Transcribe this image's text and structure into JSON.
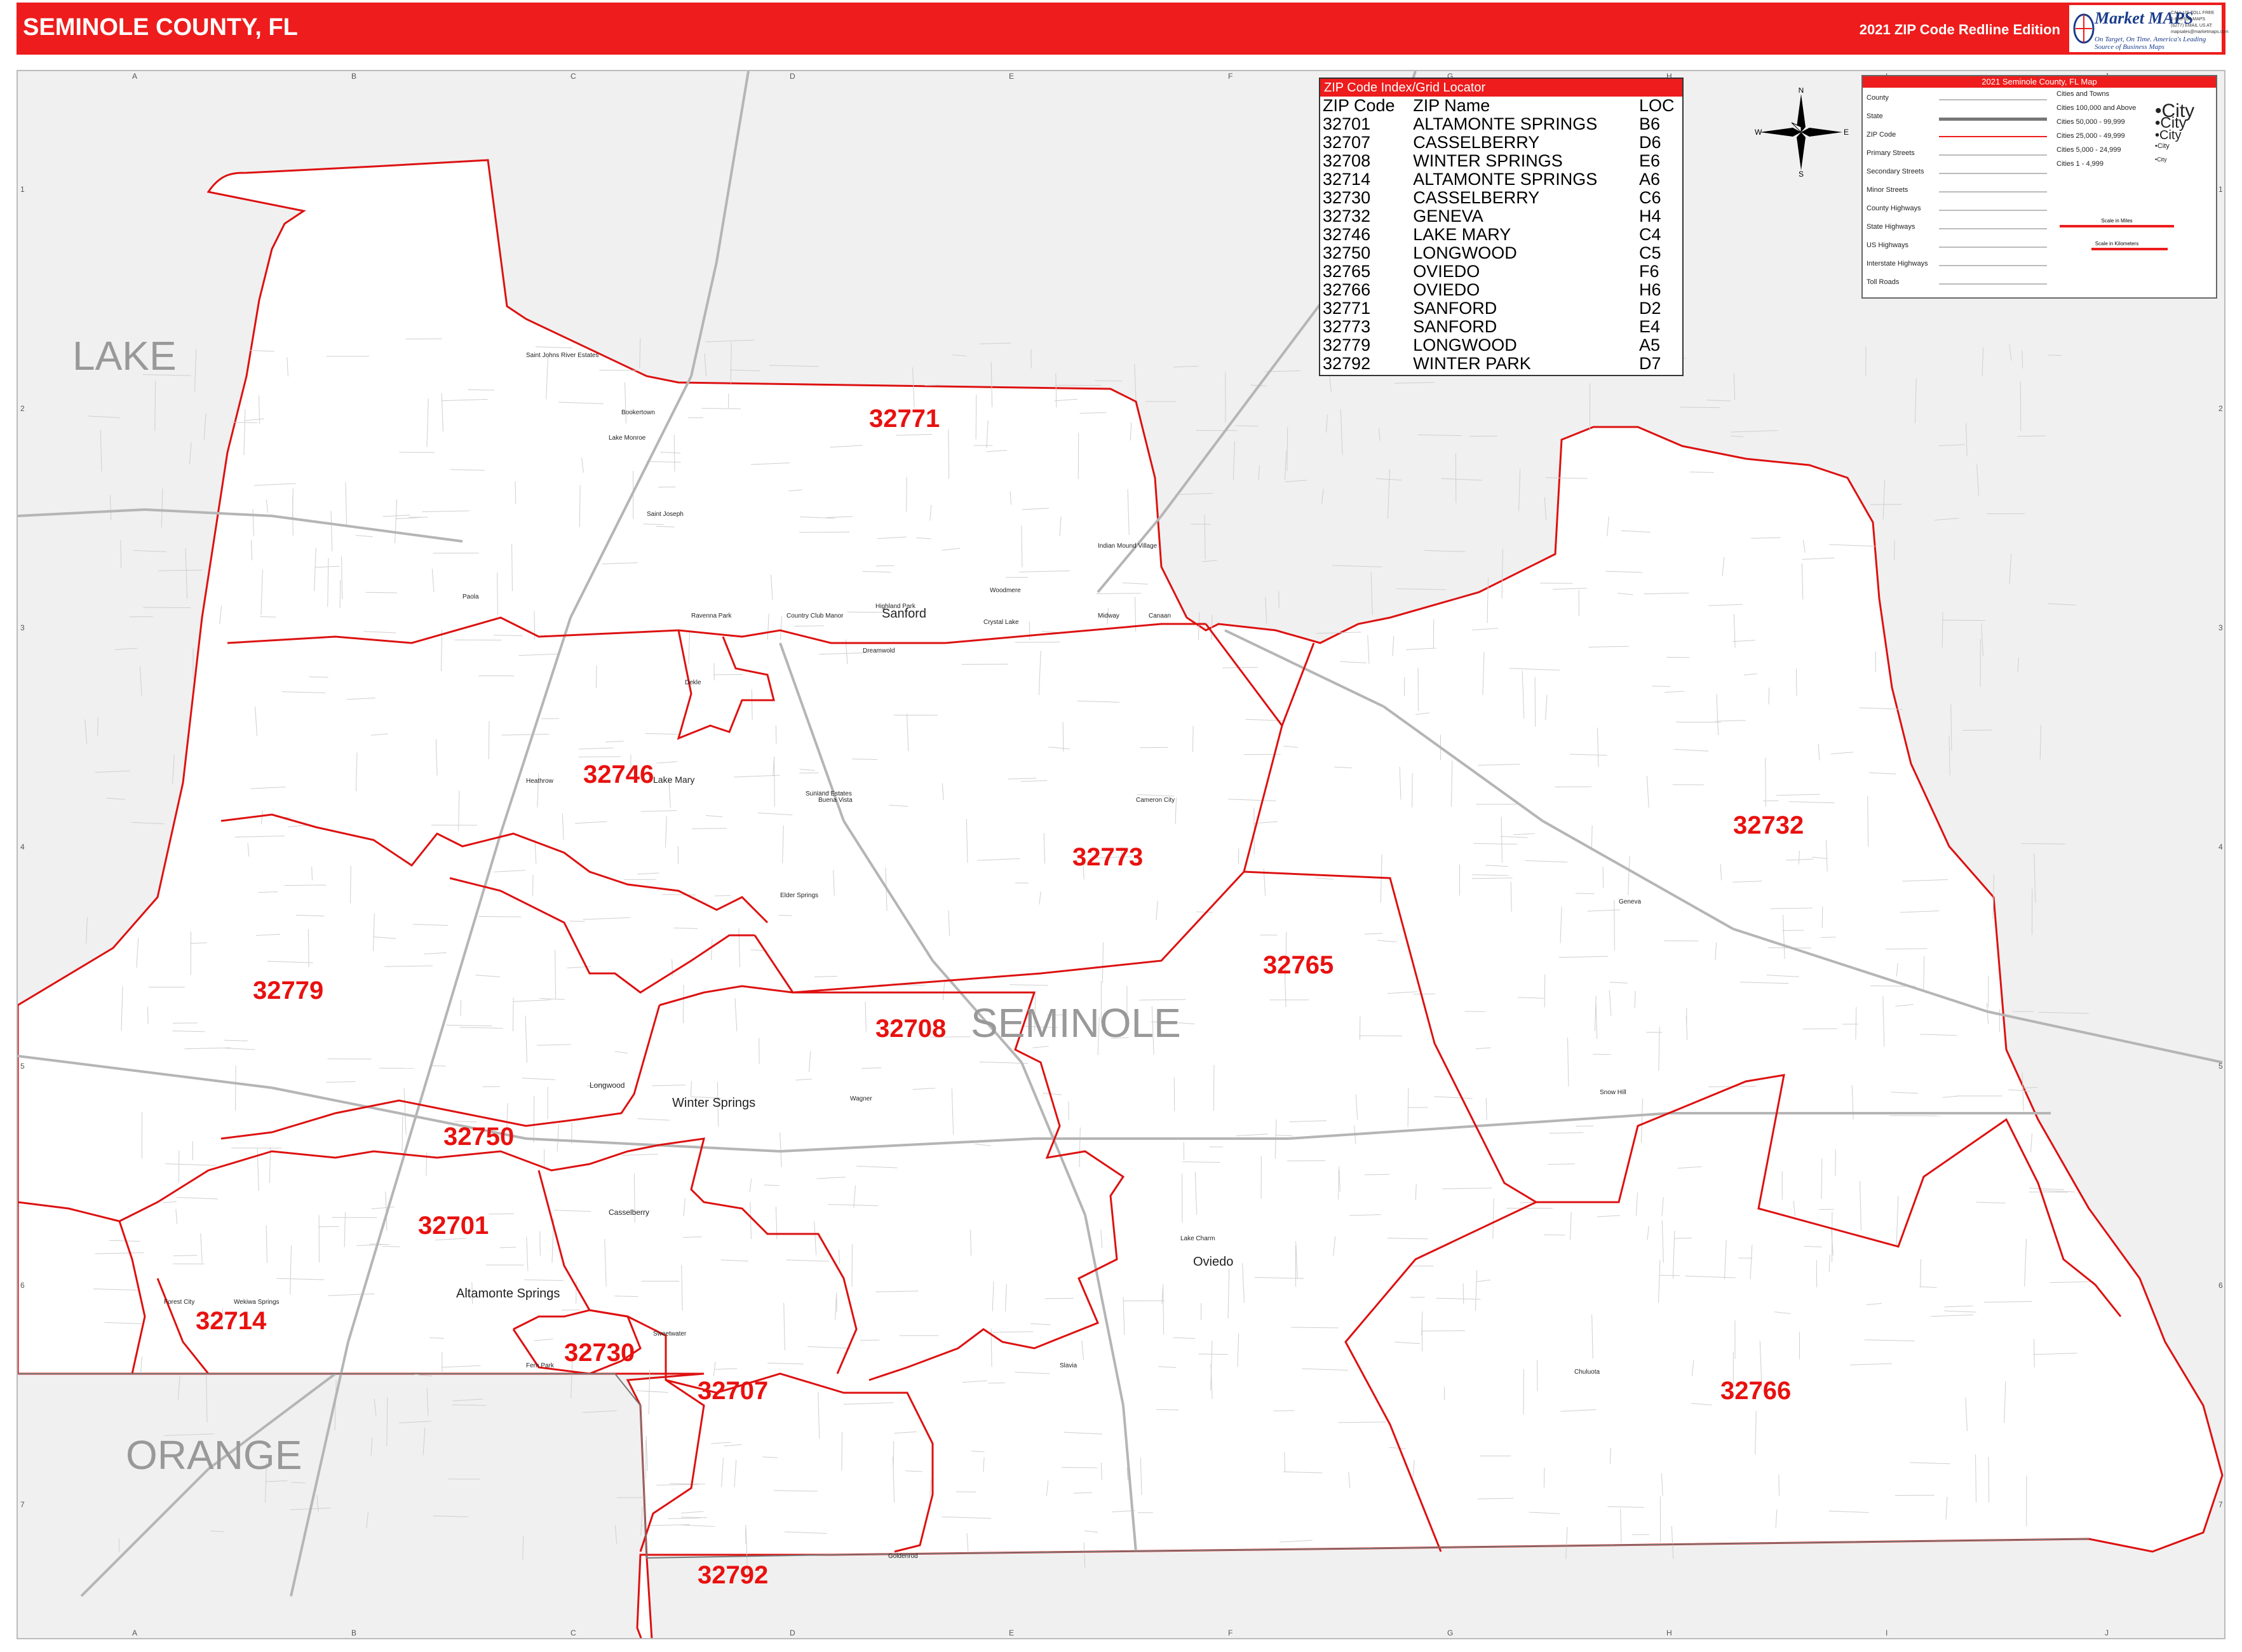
{
  "header": {
    "title": "SEMINOLE COUNTY, FL",
    "edition": "2021 ZIP Code Redline Edition"
  },
  "logo": {
    "name": "Market MAPS",
    "tagline": "On Target, On Time. America's Leading Source of Business Maps",
    "contact": "CALL US TOLL FREE 1-800-654-MAPS (6277) EMAIL US AT: mapsales@marketmaps.com"
  },
  "colors": {
    "accent": "#ee1c1c",
    "zip_boundary": "#dd1111",
    "roads": "#bbbbbb",
    "outside_county": "#f0f0f0",
    "county_label": "#999999"
  },
  "compass": {
    "n": "N",
    "s": "S",
    "e": "E",
    "w": "W"
  },
  "index": {
    "title": "ZIP Code Index/Grid Locator",
    "columns": [
      "ZIP Code",
      "ZIP Name",
      "LOC"
    ],
    "rows": [
      [
        "32701",
        "ALTAMONTE SPRINGS",
        "B6"
      ],
      [
        "32707",
        "CASSELBERRY",
        "D6"
      ],
      [
        "32708",
        "WINTER SPRINGS",
        "E6"
      ],
      [
        "32714",
        "ALTAMONTE SPRINGS",
        "A6"
      ],
      [
        "32730",
        "CASSELBERRY",
        "C6"
      ],
      [
        "32732",
        "GENEVA",
        "H4"
      ],
      [
        "32746",
        "LAKE MARY",
        "C4"
      ],
      [
        "32750",
        "LONGWOOD",
        "C5"
      ],
      [
        "32765",
        "OVIEDO",
        "F6"
      ],
      [
        "32766",
        "OVIEDO",
        "H6"
      ],
      [
        "32771",
        "SANFORD",
        "D2"
      ],
      [
        "32773",
        "SANFORD",
        "E4"
      ],
      [
        "32779",
        "LONGWOOD",
        "A5"
      ],
      [
        "32792",
        "WINTER PARK",
        "D7"
      ]
    ]
  },
  "legend": {
    "title": "2021 Seminole County, FL Map",
    "items": [
      "County",
      "State",
      "ZIP Code",
      "Primary Streets",
      "Secondary Streets",
      "Minor Streets",
      "County Highways",
      "State Highways",
      "US Highways",
      "Interstate Highways",
      "Toll Roads"
    ],
    "cities_title": "Cities and Towns",
    "city_classes": [
      {
        "label": "Cities 100,000 and Above",
        "sample": "City"
      },
      {
        "label": "Cities 50,000 - 99,999",
        "sample": "City"
      },
      {
        "label": "Cities 25,000 - 49,999",
        "sample": "City"
      },
      {
        "label": "Cities 5,000 - 24,999",
        "sample": "City"
      },
      {
        "label": "Cities 1 - 4,999",
        "sample": "City"
      }
    ],
    "scale_miles": "Scale in Miles",
    "scale_km": "Scale in Kilometers"
  },
  "grid": {
    "columns": [
      "A",
      "B",
      "C",
      "D",
      "E",
      "F",
      "G",
      "H",
      "I",
      "J"
    ],
    "rows": [
      "1",
      "2",
      "3",
      "4",
      "5",
      "6",
      "7"
    ]
  },
  "counties": {
    "lake": "LAKE",
    "orange": "ORANGE",
    "seminole": "SEMINOLE"
  },
  "zip_labels": [
    "32771",
    "32746",
    "32773",
    "32732",
    "32779",
    "32765",
    "32708",
    "32750",
    "32701",
    "32714",
    "32730",
    "32707",
    "32766",
    "32792"
  ],
  "places": [
    "Sanford",
    "Lake Mary",
    "Winter Springs",
    "Longwood",
    "Casselberry",
    "Altamonte Springs",
    "Oviedo",
    "Geneva",
    "Chuluota",
    "Forest City",
    "Wekiwa Springs",
    "Fern Park",
    "Goldenrod",
    "Slavia",
    "Sweetwater",
    "Saint Johns River Estates",
    "Lake Monroe",
    "Bookertown",
    "Midway",
    "Canaan",
    "Country Club Manor",
    "Highland Park",
    "Ravenna Park",
    "Elder Springs",
    "Cameron City",
    "Heathrow",
    "Paola",
    "Indian Mound Village",
    "Dreamwold",
    "Dekle",
    "Buena Vista",
    "Snow Hill",
    "Lake Charm",
    "Wagner",
    "Suniand Estates",
    "Crystal Lake",
    "Woodmere",
    "Saint Joseph"
  ]
}
